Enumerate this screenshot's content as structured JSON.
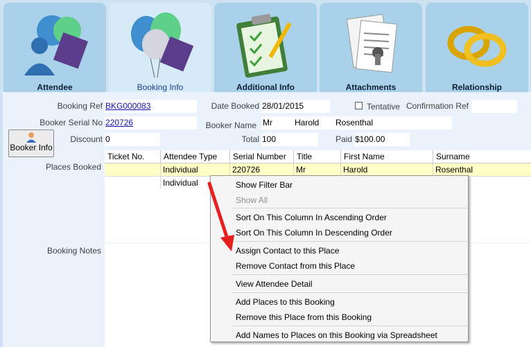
{
  "tabs": [
    {
      "label": "Attendee"
    },
    {
      "label": "Booking Info"
    },
    {
      "label": "Additional Info"
    },
    {
      "label": "Attachments"
    },
    {
      "label": "Relationship"
    }
  ],
  "form": {
    "booking_ref_label": "Booking Ref",
    "booking_ref_value": "BKG000083",
    "date_booked_label": "Date Booked",
    "date_booked_value": "28/01/2015",
    "tentative_label": "Tentative",
    "confirmation_ref_label": "Confirmation Ref",
    "confirmation_ref_value": "",
    "booker_serial_label": "Booker Serial No",
    "booker_serial_value": "220726",
    "booker_name_label": "Booker Name",
    "booker_title": "Mr",
    "booker_first": "Harold",
    "booker_last": "Rosenthal",
    "booker_info_button": "Booker Info",
    "discount_label": "Discount",
    "discount_value": "0",
    "total_label": "Total",
    "total_value": "100",
    "paid_label": "Paid",
    "paid_value": "$100.00",
    "places_booked_label": "Places Booked",
    "booking_notes_label": "Booking Notes"
  },
  "grid": {
    "headers": [
      "Ticket No.",
      "Attendee Type",
      "Serial Number",
      "Title",
      "First Name",
      "Surname"
    ],
    "rows": [
      [
        "",
        "Individual",
        "220726",
        "Mr",
        "Harold",
        "Rosenthal"
      ],
      [
        "",
        "Individual",
        "",
        "",
        "",
        ""
      ]
    ]
  },
  "context_menu": {
    "items": [
      {
        "label": "Show Filter Bar",
        "disabled": false
      },
      {
        "label": "Show All",
        "disabled": true
      },
      {
        "label": "Sort On This Column In Ascending Order",
        "disabled": false
      },
      {
        "label": "Sort On This Column In Descending Order",
        "disabled": false
      },
      {
        "label": "Assign Contact to this Place",
        "disabled": false
      },
      {
        "label": "Remove Contact from this Place",
        "disabled": false
      },
      {
        "label": "View Attendee Detail",
        "disabled": false
      },
      {
        "label": "Add Places to this Booking",
        "disabled": false
      },
      {
        "label": "Remove this Place from this Booking",
        "disabled": false
      },
      {
        "label": "Add Names to Places on this Booking via Spreadsheet",
        "disabled": false
      }
    ]
  },
  "colors": {
    "selected_row": "#ffffc6",
    "arrow": "#e81f1f"
  }
}
